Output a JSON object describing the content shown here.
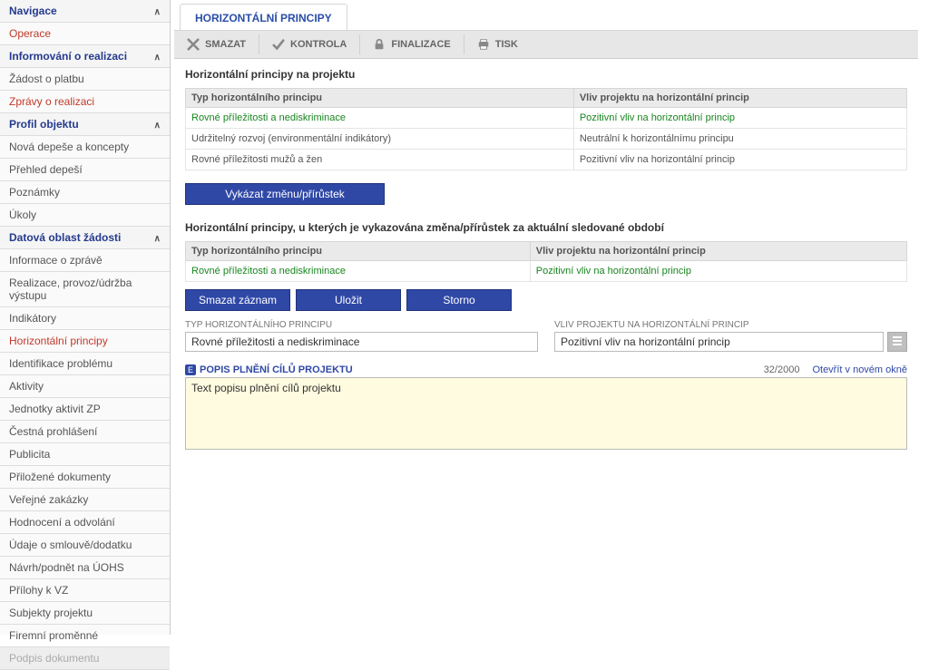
{
  "sidebar": {
    "groups": [
      {
        "header": "Navigace",
        "collapsible": true,
        "items": [
          {
            "label": "Operace",
            "red": true
          }
        ]
      },
      {
        "header": "Informování o realizaci",
        "collapsible": true,
        "items": [
          {
            "label": "Žádost o platbu"
          },
          {
            "label": "Zprávy o realizaci",
            "red": true
          }
        ]
      },
      {
        "header": "Profil objektu",
        "collapsible": true,
        "items": [
          {
            "label": "Nová depeše a koncepty"
          },
          {
            "label": "Přehled depeší"
          },
          {
            "label": "Poznámky"
          },
          {
            "label": "Úkoly"
          }
        ]
      },
      {
        "header": "Datová oblast žádosti",
        "collapsible": true,
        "items": [
          {
            "label": "Informace o zprávě"
          },
          {
            "label": "Realizace, provoz/údržba výstupu"
          },
          {
            "label": "Indikátory"
          },
          {
            "label": "Horizontální principy",
            "red": true
          },
          {
            "label": "Identifikace problému"
          },
          {
            "label": "Aktivity"
          },
          {
            "label": "Jednotky aktivit ZP"
          },
          {
            "label": "Čestná prohlášení"
          },
          {
            "label": "Publicita"
          },
          {
            "label": "Přiložené dokumenty"
          },
          {
            "label": "Veřejné zakázky"
          },
          {
            "label": "Hodnocení a odvolání"
          },
          {
            "label": "Údaje o smlouvě/dodatku"
          },
          {
            "label": "Návrh/podnět na ÚOHS"
          },
          {
            "label": "Přílohy k VZ"
          },
          {
            "label": "Subjekty projektu"
          },
          {
            "label": "Firemní proměnné"
          },
          {
            "label": "Podpis dokumentu",
            "disabled": true
          }
        ]
      }
    ]
  },
  "main": {
    "tab": "HORIZONTÁLNÍ PRINCIPY",
    "toolbar": {
      "smazat": "SMAZAT",
      "kontrola": "KONTROLA",
      "finalizace": "FINALIZACE",
      "tisk": "TISK"
    },
    "section1_title": "Horizontální principy na projektu",
    "table1": {
      "col1": "Typ horizontálního principu",
      "col2": "Vliv projektu na horizontální princip",
      "rows": [
        {
          "c1": "Rovné příležitosti a nediskriminace",
          "c2": "Pozitivní vliv na horizontální princip",
          "green": true
        },
        {
          "c1": "Udržitelný rozvoj (environmentální indikátory)",
          "c2": "Neutrální k horizontálnímu principu"
        },
        {
          "c1": "Rovné příležitosti mužů a žen",
          "c2": "Pozitivní vliv na horizontální princip"
        }
      ]
    },
    "vykazat_btn": "Vykázat změnu/přírůstek",
    "section2_title": "Horizontální principy, u kterých je vykazována změna/přírůstek za aktuální sledované období",
    "table2": {
      "col1": "Typ horizontálního principu",
      "col2": "Vliv projektu na horizontální princip",
      "rows": [
        {
          "c1": "Rovné příležitosti a nediskriminace",
          "c2": "Pozitivní vliv na horizontální princip",
          "green": true
        }
      ]
    },
    "buttons": {
      "smazat_zaznam": "Smazat záznam",
      "ulozit": "Uložit",
      "storno": "Storno"
    },
    "form": {
      "typ_label": "TYP HORIZONTÁLNÍHO PRINCIPU",
      "typ_value": "Rovné příležitosti a nediskriminace",
      "vliv_label": "VLIV PROJEKTU NA HORIZONTÁLNÍ PRINCIP",
      "vliv_value": "Pozitivní vliv na horizontální princip"
    },
    "desc": {
      "req": "E",
      "label": "POPIS PLNĚNÍ CÍLŮ PROJEKTU",
      "count": "32/2000",
      "open": "Otevřít v novém okně",
      "text": "Text popisu plnění cílů projektu"
    }
  }
}
